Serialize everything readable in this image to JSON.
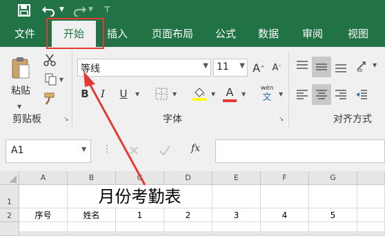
{
  "qat": {
    "save_icon": "save-icon",
    "undo_icon": "undo-icon",
    "redo_icon": "redo-icon",
    "customize_icon": "customize-icon"
  },
  "tabs": [
    "文件",
    "开始",
    "插入",
    "页面布局",
    "公式",
    "数据",
    "审阅",
    "视图"
  ],
  "ribbon": {
    "clipboard": {
      "paste_label": "粘贴",
      "group_label": "剪贴板"
    },
    "font": {
      "font_name": "等线",
      "font_size": "11",
      "group_label": "字体",
      "bold": "B",
      "italic": "I",
      "underline": "U",
      "wen_top": "wén",
      "wen_bottom": "文",
      "font_color_glyph": "A"
    },
    "alignment": {
      "group_label": "对齐方式"
    }
  },
  "formula_bar": {
    "name_box": "A1",
    "fx": "fx",
    "value": ""
  },
  "sheet": {
    "columns": [
      "A",
      "B",
      "C",
      "D",
      "E",
      "F",
      "G"
    ],
    "rows": [
      "1",
      "2"
    ],
    "title": "月份考勤表",
    "row2": [
      "序号",
      "姓名",
      "1",
      "2",
      "3",
      "4",
      "5"
    ]
  },
  "colors": {
    "accent": "#217346",
    "annotation": "#e53935"
  }
}
